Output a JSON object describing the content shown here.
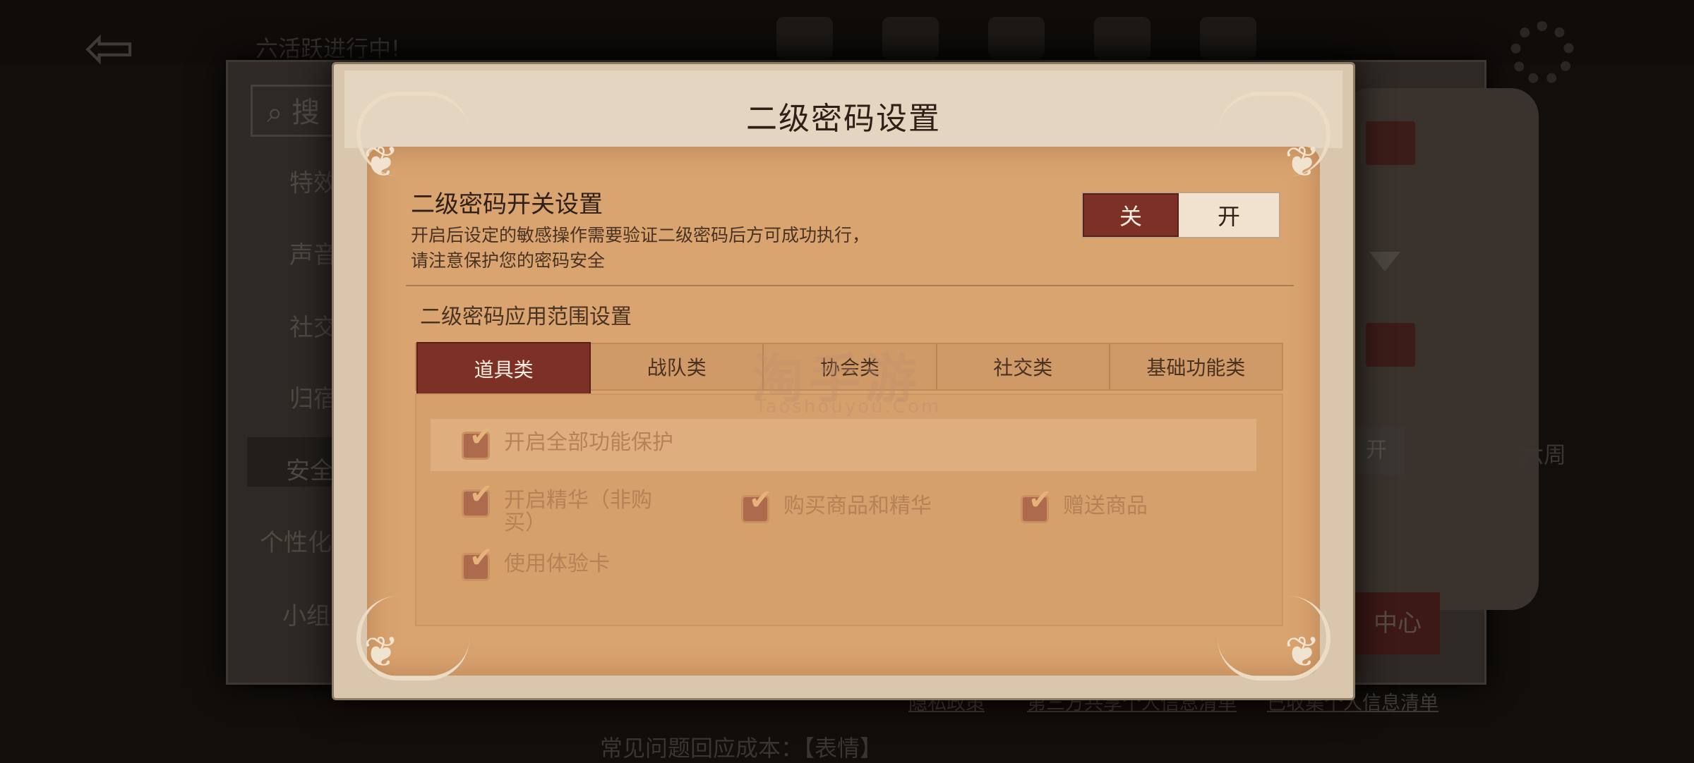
{
  "background": {
    "status_text": "六活跃进行中!",
    "search_placeholder": "搜",
    "sidebar": [
      "特效",
      "声音",
      "社交",
      "归宿",
      "安全",
      "个性化",
      "小组"
    ],
    "mini_button": "开",
    "right_text": "六周",
    "center_button": "中心",
    "footer_links": [
      "隐私政策",
      "第三方共享个人信息清单",
      "已收集个人信息清单"
    ],
    "bottom_text": "常见问题回应成本：【表情】"
  },
  "modal": {
    "title": "二级密码设置",
    "switch": {
      "title": "二级密码开关设置",
      "description": "开启后设定的敏感操作需要验证二级密码后方可成功执行，请注意保护您的密码安全",
      "off_label": "关",
      "on_label": "开",
      "state": "off"
    },
    "scope_title": "二级密码应用范围设置",
    "tabs": [
      "道具类",
      "战队类",
      "协会类",
      "社交类",
      "基础功能类"
    ],
    "active_tab": "道具类",
    "options": {
      "all": "开启全部功能保护",
      "essence": "开启精华（非购买）",
      "buy": "购买商品和精华",
      "gift": "赠送商品",
      "trial": "使用体验卡"
    }
  },
  "watermark": {
    "main": "淘手游",
    "sub": "Taoshouyou.Com"
  },
  "colors": {
    "accent_red": "#7d3126",
    "panel_tan": "#d9a470",
    "header_cream": "#e4d5c0"
  },
  "icons": {
    "back": "exit-door-icon",
    "search": "search-icon",
    "settings": "gear-icon",
    "checkbox": "check-icon"
  }
}
